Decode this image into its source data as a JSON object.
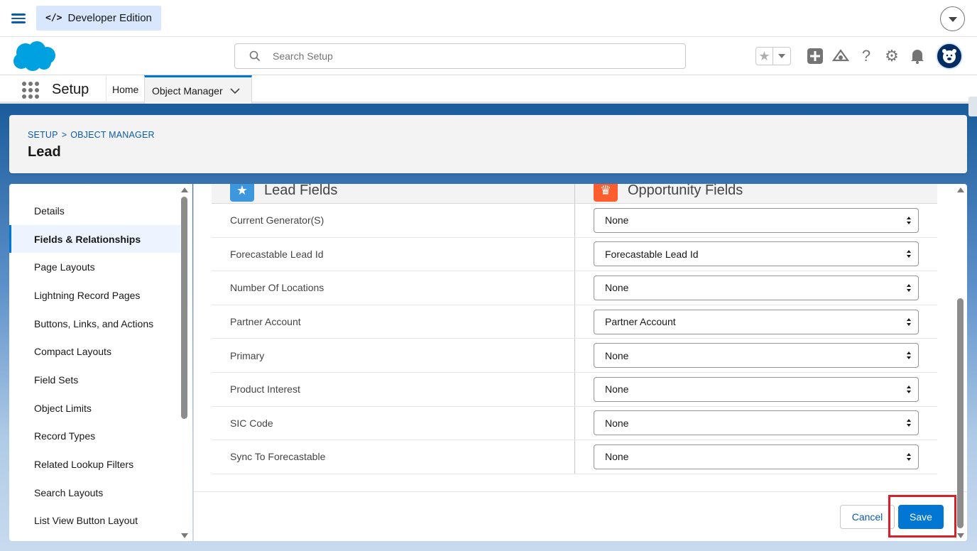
{
  "devbar": {
    "badge_label": "Developer Edition",
    "badge_icon": "code-icon"
  },
  "header": {
    "search_placeholder": "Search Setup"
  },
  "appnav": {
    "app_name": "Setup",
    "home_label": "Home",
    "object_manager_label": "Object Manager"
  },
  "page_header": {
    "breadcrumb": [
      "SETUP",
      "OBJECT MANAGER"
    ],
    "breadcrumb_separator": ">",
    "title": "Lead"
  },
  "sidebar": {
    "items": [
      {
        "label": "Details",
        "active": false
      },
      {
        "label": "Fields & Relationships",
        "active": true
      },
      {
        "label": "Page Layouts",
        "active": false
      },
      {
        "label": "Lightning Record Pages",
        "active": false
      },
      {
        "label": "Buttons, Links, and Actions",
        "active": false
      },
      {
        "label": "Compact Layouts",
        "active": false
      },
      {
        "label": "Field Sets",
        "active": false
      },
      {
        "label": "Object Limits",
        "active": false
      },
      {
        "label": "Record Types",
        "active": false
      },
      {
        "label": "Related Lookup Filters",
        "active": false
      },
      {
        "label": "Search Layouts",
        "active": false
      },
      {
        "label": "List View Button Layout",
        "active": false
      }
    ]
  },
  "mapping": {
    "lead_header": "Lead Fields",
    "opp_header": "Opportunity Fields",
    "rows": [
      {
        "lead_field": "Current Generator(S)",
        "opp_field": "None"
      },
      {
        "lead_field": "Forecastable Lead Id",
        "opp_field": "Forecastable Lead Id"
      },
      {
        "lead_field": "Number Of Locations",
        "opp_field": "None"
      },
      {
        "lead_field": "Partner Account",
        "opp_field": "Partner Account"
      },
      {
        "lead_field": "Primary",
        "opp_field": "None"
      },
      {
        "lead_field": "Product Interest",
        "opp_field": "None"
      },
      {
        "lead_field": "SIC Code",
        "opp_field": "None"
      },
      {
        "lead_field": "Sync To Forecastable",
        "opp_field": "None"
      }
    ]
  },
  "actions": {
    "cancel_label": "Cancel",
    "save_label": "Save"
  },
  "colors": {
    "brand": "#0176d3",
    "highlight": "#d6202a",
    "lead_icon": "#3c97dd",
    "opp_icon": "#ff5d2d"
  }
}
